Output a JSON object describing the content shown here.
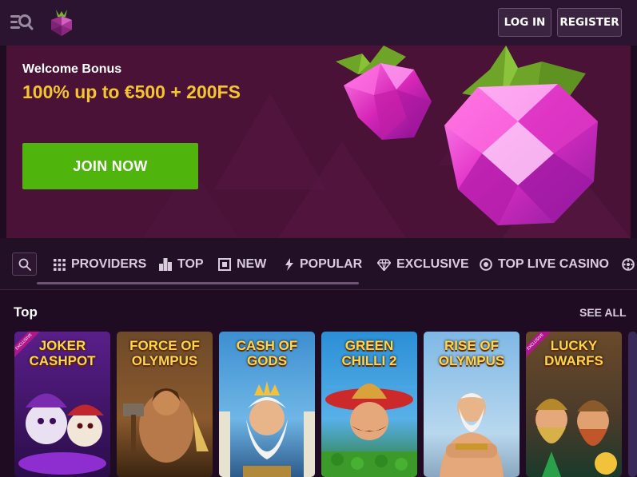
{
  "header": {
    "login_label": "LOG IN",
    "register_label": "REGISTER"
  },
  "hero": {
    "bonus_title": "Welcome Bonus",
    "bonus_offer": "100% up to €500 + 200FS",
    "join_label": "JOIN NOW"
  },
  "categories": [
    {
      "label": "PROVIDERS",
      "icon": "grid-icon"
    },
    {
      "label": "TOP",
      "icon": "podium-icon"
    },
    {
      "label": "NEW",
      "icon": "new-icon"
    },
    {
      "label": "POPULAR",
      "icon": "lightning-icon"
    },
    {
      "label": "EXCLUSIVE",
      "icon": "diamond-icon"
    },
    {
      "label": "TOP LIVE CASINO",
      "icon": "chip-icon"
    }
  ],
  "section": {
    "title": "Top",
    "see_all_label": "SEE ALL"
  },
  "games": [
    {
      "name": "JOKER\nCASHPOT",
      "exclusive": true
    },
    {
      "name": "FORCE OF\nOLYMPUS",
      "exclusive": false
    },
    {
      "name": "CASH OF\nGODS",
      "exclusive": false
    },
    {
      "name": "GREEN\nCHILLI 2",
      "exclusive": false
    },
    {
      "name": "RISE OF\nOLYMPUS",
      "exclusive": false
    },
    {
      "name": "LUCKY\nDWARFS",
      "exclusive": true
    }
  ],
  "ribbon_label": "EXCLUSIVE",
  "colors": {
    "accent_green": "#4fb40b",
    "offer_yellow": "#f5c431",
    "hero_bg": "#4a1236",
    "page_bg": "#1f0c22"
  }
}
